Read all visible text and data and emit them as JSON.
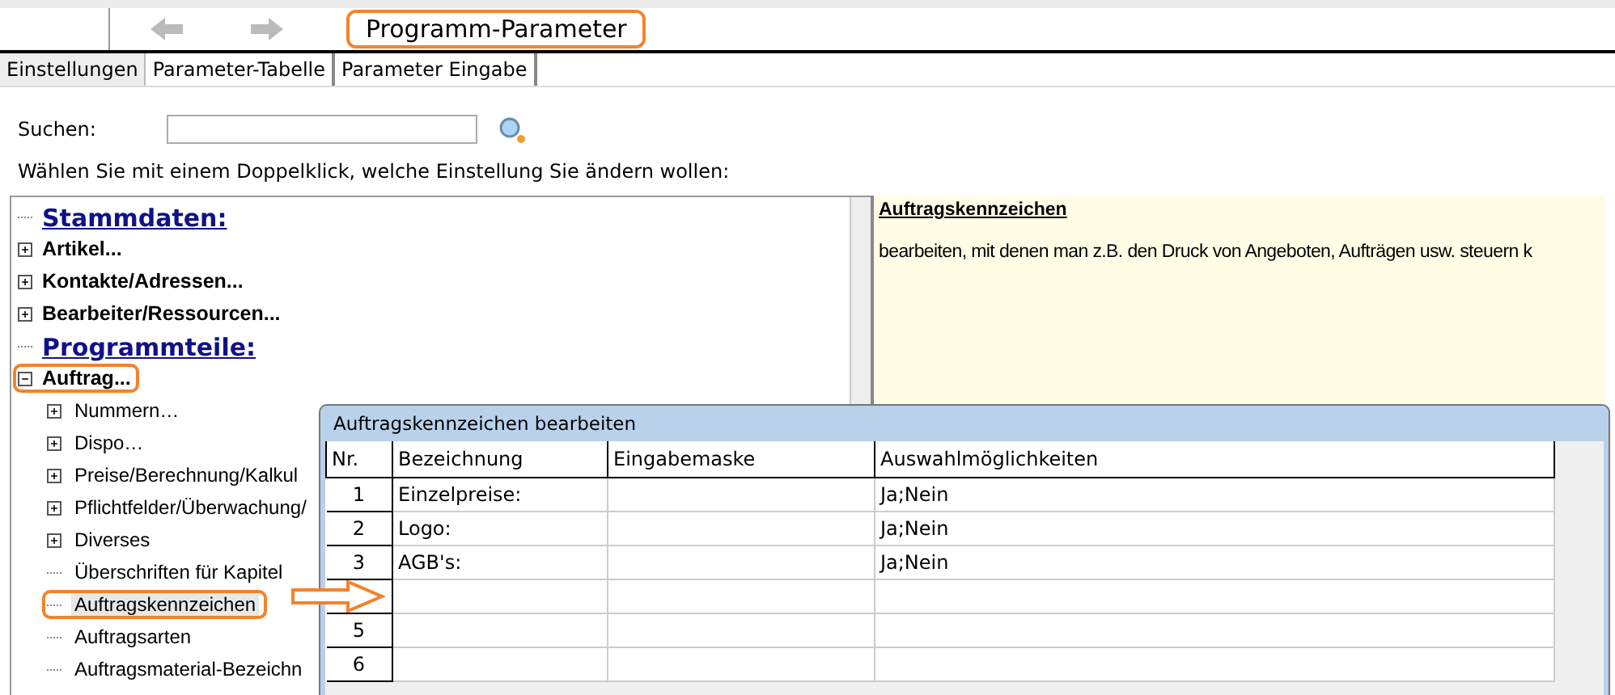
{
  "window": {
    "title": "Programm-Parameter",
    "highlighted": true
  },
  "tabs": [
    {
      "label": "Einstellungen",
      "selected": true
    },
    {
      "label": "Parameter-Tabelle",
      "selected": false
    },
    {
      "label": "Parameter Eingabe",
      "selected": false
    }
  ],
  "search": {
    "label": "Suchen:"
  },
  "instruction": "Wählen Sie mit einem Doppelklick, welche Einstellung Sie ändern wollen:",
  "tree": [
    {
      "kind": "heading",
      "label": "Stammdaten:"
    },
    {
      "kind": "group",
      "label": "Artikel...",
      "expanded": false,
      "highlighted": false
    },
    {
      "kind": "group",
      "label": "Kontakte/Adressen...",
      "expanded": false,
      "highlighted": false
    },
    {
      "kind": "group",
      "label": "Bearbeiter/Ressourcen...",
      "expanded": false,
      "highlighted": false
    },
    {
      "kind": "heading",
      "label": "Programmteile:"
    },
    {
      "kind": "group",
      "label": "Auftrag...",
      "expanded": true,
      "highlighted": true,
      "children": [
        {
          "kind": "node",
          "label": "Nummern…",
          "expanded": false,
          "selected": false,
          "highlighted": false
        },
        {
          "kind": "node",
          "label": "Dispo…",
          "expanded": false,
          "selected": false,
          "highlighted": false
        },
        {
          "kind": "node",
          "label": "Preise/Berechnung/Kalkul",
          "expanded": false,
          "selected": false,
          "highlighted": false
        },
        {
          "kind": "node",
          "label": "Pflichtfelder/Überwachung/",
          "expanded": false,
          "selected": false,
          "highlighted": false
        },
        {
          "kind": "node",
          "label": "Diverses",
          "expanded": false,
          "selected": false,
          "highlighted": false
        },
        {
          "kind": "leaf",
          "label": "Überschriften für Kapitel",
          "selected": false,
          "highlighted": false
        },
        {
          "kind": "leaf",
          "label": "Auftragskennzeichen",
          "selected": true,
          "highlighted": true
        },
        {
          "kind": "leaf",
          "label": "Auftragsarten",
          "selected": false,
          "highlighted": false
        },
        {
          "kind": "leaf",
          "label": "Auftragsmaterial-Bezeichn",
          "selected": false,
          "highlighted": false
        }
      ]
    }
  ],
  "info": {
    "title": "Auftragskennzeichen",
    "text": "bearbeiten, mit denen man z.B. den Druck von Angeboten, Aufträgen usw. steuern  k"
  },
  "dialog": {
    "title": "Auftragskennzeichen bearbeiten",
    "columns": [
      "Nr.",
      "Bezeichnung",
      "Eingabemaske",
      "Auswahlmöglichkeiten"
    ],
    "rows": [
      {
        "nr": "1",
        "bezeichnung": "Einzelpreise:",
        "auswahl": "Ja;Nein"
      },
      {
        "nr": "2",
        "bezeichnung": "Logo:",
        "auswahl": "Ja;Nein"
      },
      {
        "nr": "3",
        "bezeichnung": "AGB's:",
        "auswahl": "Ja;Nein"
      },
      {},
      {
        "nr": "5"
      },
      {
        "nr": "6"
      }
    ]
  }
}
